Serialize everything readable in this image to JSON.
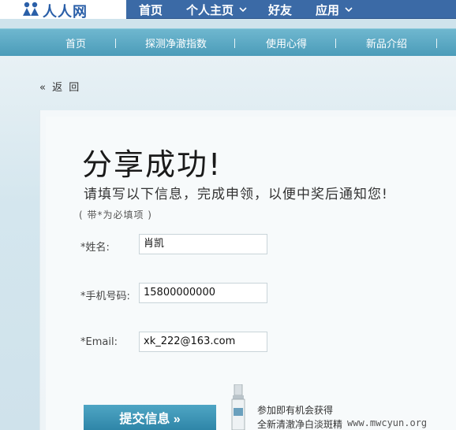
{
  "header": {
    "logo_text": "人人网",
    "nav": [
      {
        "label": "首页"
      },
      {
        "label": "个人主页"
      },
      {
        "label": "好友"
      },
      {
        "label": "应用"
      }
    ]
  },
  "subnav": [
    {
      "label": "首页"
    },
    {
      "label": "探测净澈指数"
    },
    {
      "label": "使用心得"
    },
    {
      "label": "新品介绍"
    }
  ],
  "back": "« 返 回",
  "main": {
    "title": "分享成功!",
    "subtitle": "请填写以下信息，完成申领，以便中奖后通知您!",
    "required_note": "( 带*为必填项 )",
    "fields": [
      {
        "label": "*姓名:",
        "value": "肖凯"
      },
      {
        "label": "*手机号码:",
        "value": "15800000000"
      },
      {
        "label": "*Email:",
        "value": "xk_222@163.com"
      }
    ],
    "submit_label": "提交信息 »"
  },
  "promo": {
    "line1": "参加即有机会获得",
    "line2": "全新清澈净白淡斑精",
    "watermark": "www.mwcyun.org"
  },
  "colors": {
    "nav_bg": "#3b6aa6",
    "subnav_bg": "#4b9cb9",
    "button_bg": "#2f86a8"
  }
}
